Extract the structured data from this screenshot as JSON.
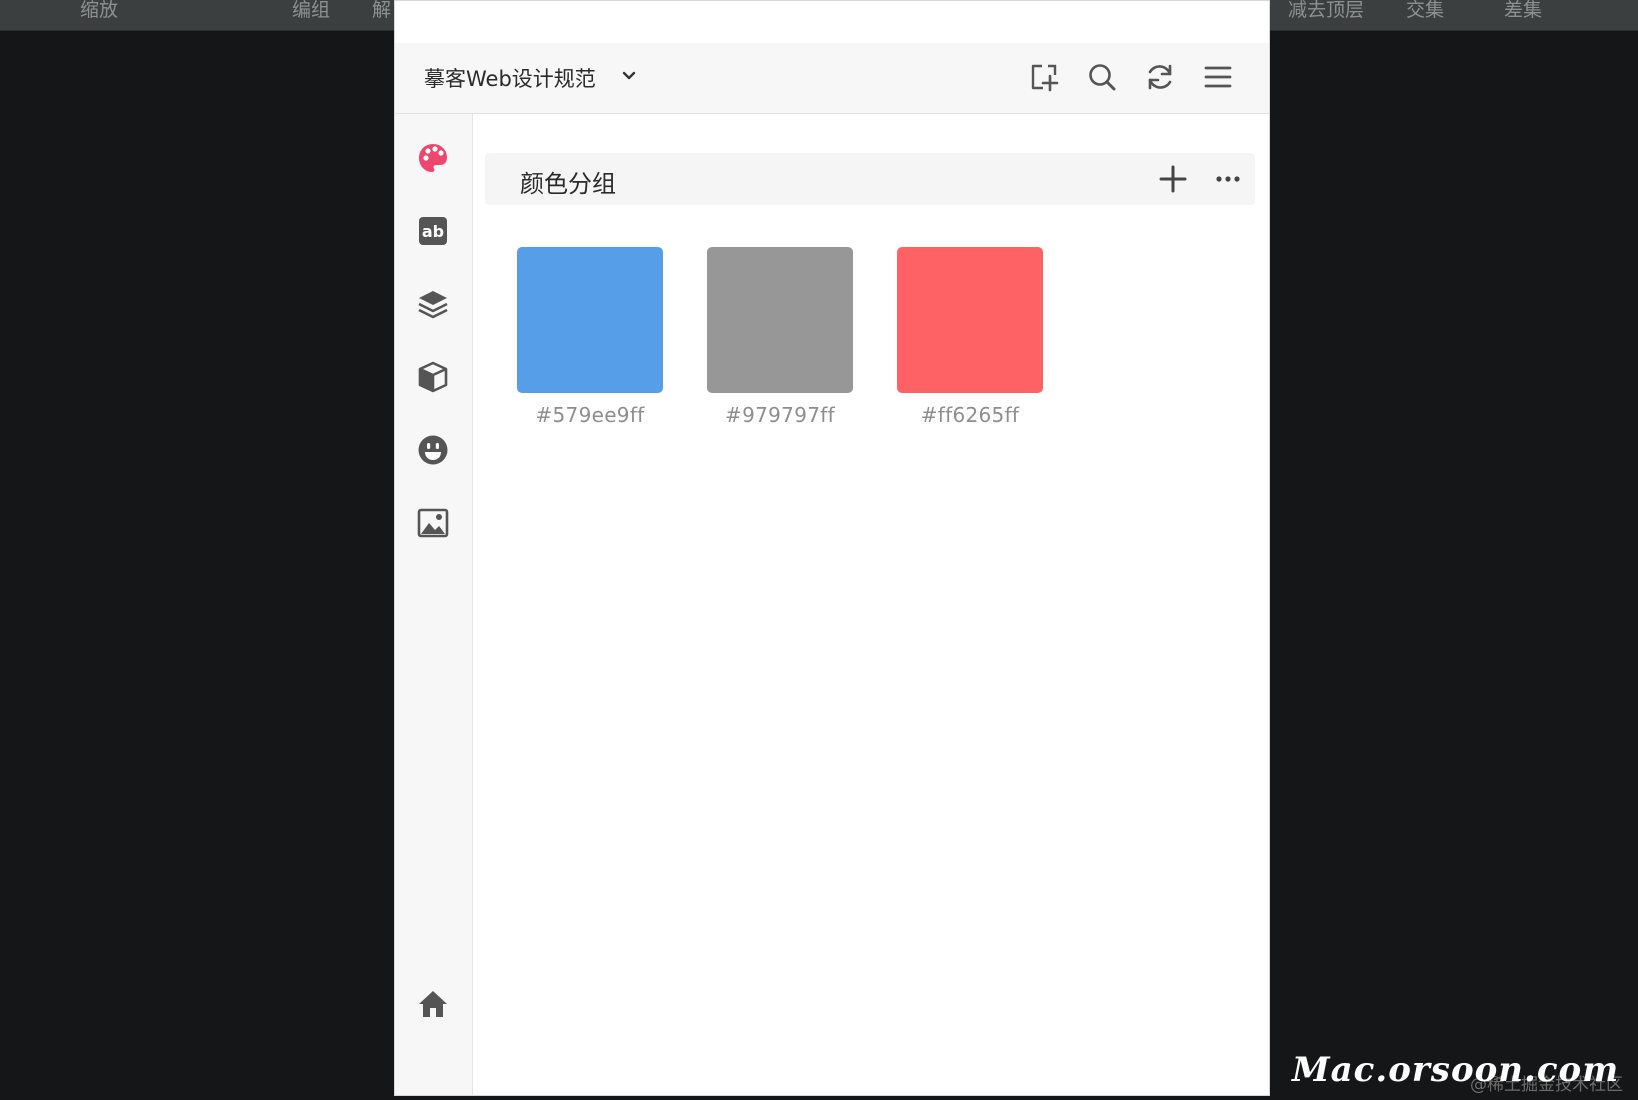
{
  "host_toolbar": {
    "items": [
      "缩放",
      "编组",
      "解",
      "减去顶层",
      "交集",
      "差集"
    ]
  },
  "panel": {
    "project_title": "摹客Web设计规范",
    "header_icons": [
      "add-artboard-icon",
      "search-icon",
      "refresh-icon",
      "menu-icon"
    ],
    "sidebar_icons": [
      "palette-icon",
      "text-style-icon",
      "layers-icon",
      "component-icon",
      "emoji-icon",
      "image-icon",
      "home-icon"
    ],
    "accent_color": "#f0466e",
    "group": {
      "title": "颜色分组",
      "actions": [
        "add-icon",
        "more-icon"
      ]
    },
    "swatches": [
      {
        "color": "#579ee9",
        "label": "#579ee9ff"
      },
      {
        "color": "#979797",
        "label": "#979797ff"
      },
      {
        "color": "#ff6265",
        "label": "#ff6265ff"
      }
    ]
  },
  "watermark": "Mac.orsoon.com",
  "credit": "@稀土掘金技术社区"
}
